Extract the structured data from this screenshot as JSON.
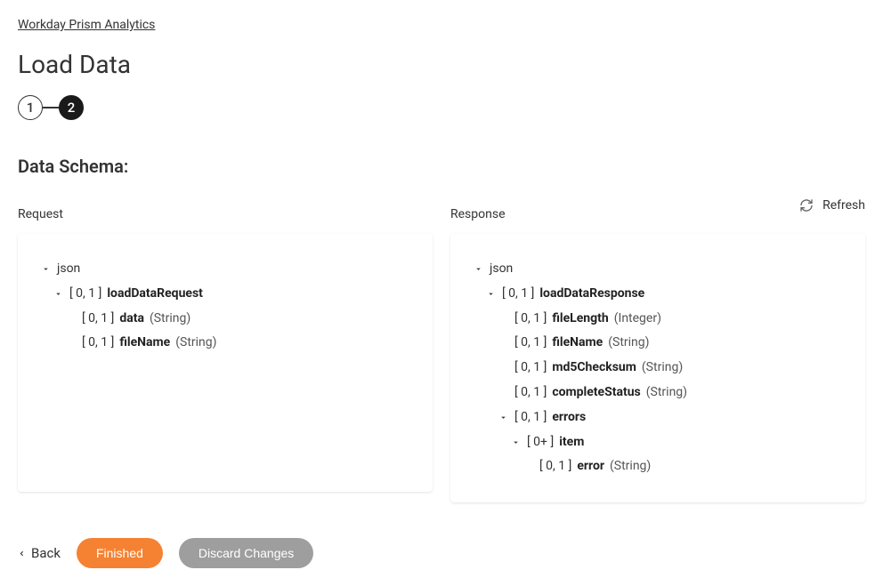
{
  "breadcrumb": "Workday Prism Analytics",
  "page_title": "Load Data",
  "stepper": {
    "step1": "1",
    "step2": "2"
  },
  "section_title": "Data Schema:",
  "refresh_label": "Refresh",
  "columns": {
    "request": "Request",
    "response": "Response"
  },
  "request_tree": {
    "root": "json",
    "n1_card": "[ 0, 1 ]",
    "n1_name": "loadDataRequest",
    "n1a_card": "[ 0, 1 ]",
    "n1a_name": "data",
    "n1a_type": "(String)",
    "n1b_card": "[ 0, 1 ]",
    "n1b_name": "fileName",
    "n1b_type": "(String)"
  },
  "response_tree": {
    "root": "json",
    "n1_card": "[ 0, 1 ]",
    "n1_name": "loadDataResponse",
    "n1a_card": "[ 0, 1 ]",
    "n1a_name": "fileLength",
    "n1a_type": "(Integer)",
    "n1b_card": "[ 0, 1 ]",
    "n1b_name": "fileName",
    "n1b_type": "(String)",
    "n1c_card": "[ 0, 1 ]",
    "n1c_name": "md5Checksum",
    "n1c_type": "(String)",
    "n1d_card": "[ 0, 1 ]",
    "n1d_name": "completeStatus",
    "n1d_type": "(String)",
    "n1e_card": "[ 0, 1 ]",
    "n1e_name": "errors",
    "n1e1_card": "[ 0+ ]",
    "n1e1_name": "item",
    "n1e1a_card": "[ 0, 1 ]",
    "n1e1a_name": "error",
    "n1e1a_type": "(String)"
  },
  "footer": {
    "back": "Back",
    "finished": "Finished",
    "discard": "Discard Changes"
  }
}
